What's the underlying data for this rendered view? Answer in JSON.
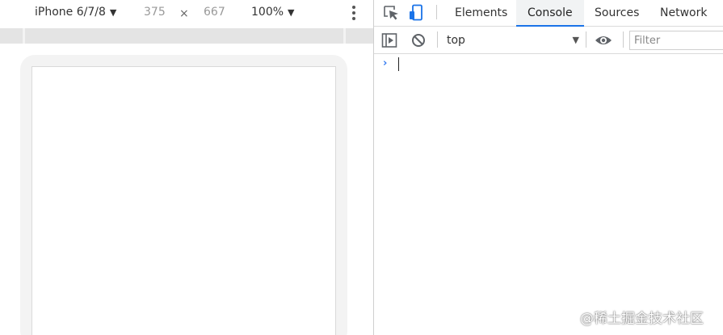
{
  "device_toolbar": {
    "device_name": "iPhone 6/7/8",
    "width_value": "375",
    "times_symbol": "×",
    "height_value": "667",
    "zoom_value": "100%",
    "caret_glyph": "▼",
    "more_icon": "more-vertical-icon"
  },
  "devtools": {
    "toolbar_icons": [
      "inspect-element-icon",
      "device-toggle-icon"
    ],
    "tabs": [
      {
        "label": "Elements"
      },
      {
        "label": "Console"
      },
      {
        "label": "Sources"
      },
      {
        "label": "Network"
      }
    ],
    "active_tab": "Console",
    "accent_color": "#1a73e8"
  },
  "console_toolbar": {
    "icons": [
      "sidebar-toggle-icon",
      "clear-console-icon",
      "eye-icon"
    ],
    "context_value": "top",
    "caret_glyph": "▼",
    "filter_placeholder": "Filter"
  },
  "console": {
    "prompt_glyph": "›"
  },
  "watermark": {
    "text": "@稀土掘金技术社区"
  }
}
